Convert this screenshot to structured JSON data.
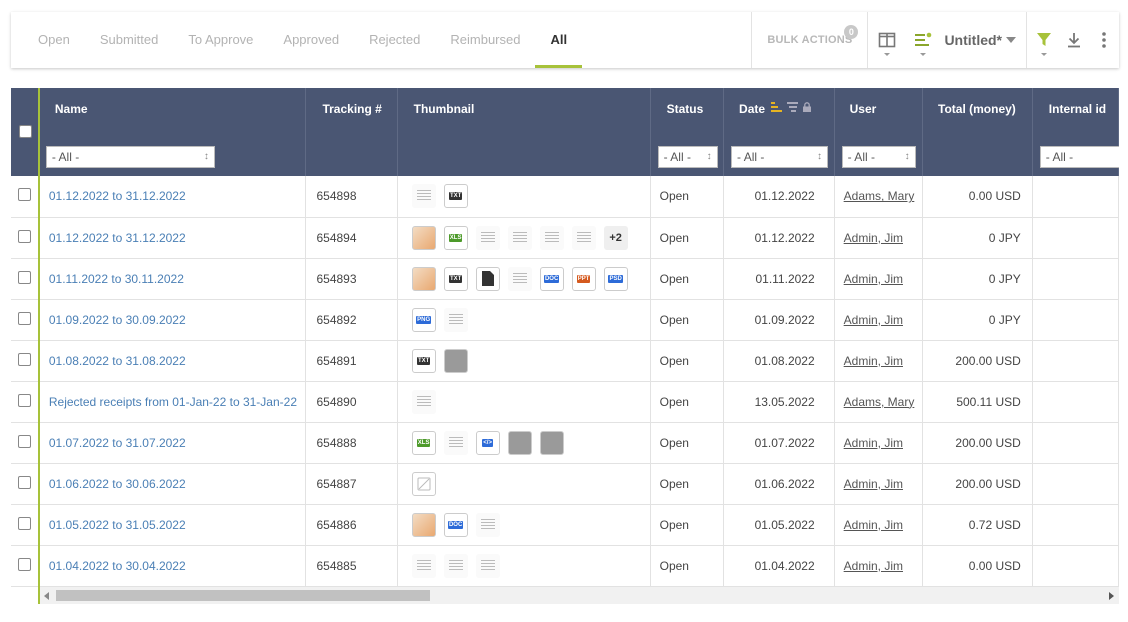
{
  "tabs": [
    {
      "label": "Open",
      "active": false
    },
    {
      "label": "Submitted",
      "active": false
    },
    {
      "label": "To Approve",
      "active": false
    },
    {
      "label": "Approved",
      "active": false
    },
    {
      "label": "Rejected",
      "active": false
    },
    {
      "label": "Reimbursed",
      "active": false
    },
    {
      "label": "All",
      "active": true
    }
  ],
  "toolbar": {
    "bulk_label": "BULK ACTIONS",
    "bulk_count": "0",
    "view_name": "Untitled*",
    "icons": [
      "columns-icon",
      "sort-lines-icon",
      "filter-icon",
      "download-icon",
      "more-vert-icon"
    ]
  },
  "colors": {
    "accent": "#a7c23a",
    "header": "#4a5673",
    "link": "#4a7fb5"
  },
  "columns": [
    {
      "label": "",
      "filter": ""
    },
    {
      "label": "Name",
      "filter": "- All -"
    },
    {
      "label": "Tracking #",
      "filter": ""
    },
    {
      "label": "Thumbnail",
      "filter": ""
    },
    {
      "label": "Status",
      "filter": "- All -"
    },
    {
      "label": "Date",
      "filter": "- All -"
    },
    {
      "label": "User",
      "filter": "- All -"
    },
    {
      "label": "Total (money)",
      "filter": ""
    },
    {
      "label": "Internal id",
      "filter": "- All -"
    }
  ],
  "rows": [
    {
      "name": "01.12.2022 to 31.12.2022",
      "tracking": "654898",
      "thumbs": [
        "doc",
        "TXT"
      ],
      "more": "",
      "status": "Open",
      "date": "01.12.2022",
      "user": "Adams, Mary",
      "total": "0.00 USD"
    },
    {
      "name": "01.12.2022 to 31.12.2022",
      "tracking": "654894",
      "thumbs": [
        "img",
        "XLS",
        "doc",
        "doc",
        "doc",
        "doc"
      ],
      "more": "+2",
      "status": "Open",
      "date": "01.12.2022",
      "user": "Admin, Jim",
      "total": "0 JPY"
    },
    {
      "name": "01.11.2022 to 30.11.2022",
      "tracking": "654893",
      "thumbs": [
        "img",
        "TXT",
        "BLK",
        "doc",
        "DOC",
        "PPT",
        "PSD"
      ],
      "more": "",
      "status": "Open",
      "date": "01.11.2022",
      "user": "Admin, Jim",
      "total": "0 JPY"
    },
    {
      "name": "01.09.2022 to 30.09.2022",
      "tracking": "654892",
      "thumbs": [
        "PNG",
        "doc"
      ],
      "more": "",
      "status": "Open",
      "date": "01.09.2022",
      "user": "Admin, Jim",
      "total": "0 JPY"
    },
    {
      "name": "01.08.2022 to 31.08.2022",
      "tracking": "654891",
      "thumbs": [
        "TXT",
        "scan"
      ],
      "more": "",
      "status": "Open",
      "date": "01.08.2022",
      "user": "Admin, Jim",
      "total": "200.00 USD"
    },
    {
      "name": "Rejected receipts from 01-Jan-22 to 31-Jan-22",
      "tracking": "654890",
      "thumbs": [
        "doc"
      ],
      "more": "",
      "status": "Open",
      "date": "13.05.2022",
      "user": "Adams, Mary",
      "total": "500.11 USD"
    },
    {
      "name": "01.07.2022 to 31.07.2022",
      "tracking": "654888",
      "thumbs": [
        "XLS",
        "doc",
        "CODE",
        "scan",
        "scan"
      ],
      "more": "",
      "status": "Open",
      "date": "01.07.2022",
      "user": "Admin, Jim",
      "total": "200.00 USD"
    },
    {
      "name": "01.06.2022 to 30.06.2022",
      "tracking": "654887",
      "thumbs": [
        "NOIMG"
      ],
      "more": "",
      "status": "Open",
      "date": "01.06.2022",
      "user": "Admin, Jim",
      "total": "200.00 USD"
    },
    {
      "name": "01.05.2022 to 31.05.2022",
      "tracking": "654886",
      "thumbs": [
        "img",
        "DOC",
        "doc"
      ],
      "more": "",
      "status": "Open",
      "date": "01.05.2022",
      "user": "Admin, Jim",
      "total": "0.72 USD"
    },
    {
      "name": "01.04.2022 to 30.04.2022",
      "tracking": "654885",
      "thumbs": [
        "doc",
        "doc",
        "doc"
      ],
      "more": "",
      "status": "Open",
      "date": "01.04.2022",
      "user": "Admin, Jim",
      "total": "0.00 USD"
    }
  ]
}
